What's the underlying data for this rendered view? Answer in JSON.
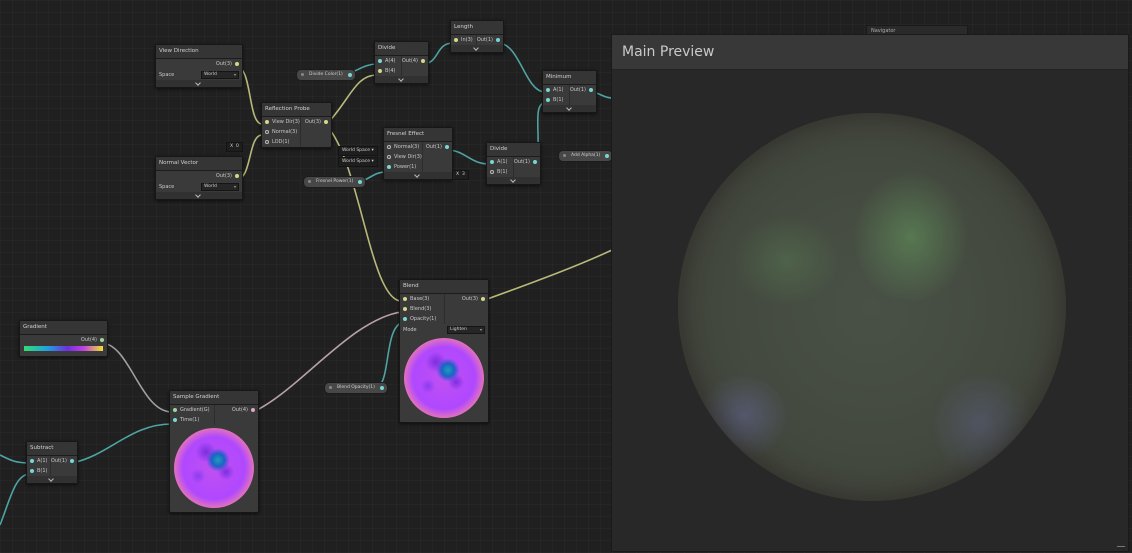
{
  "nodes": {
    "view_direction": {
      "title": "View Direction",
      "out": "Out(3)",
      "space_label": "Space",
      "space_value": "World"
    },
    "normal_vector": {
      "title": "Normal Vector",
      "out": "Out(3)",
      "space_label": "Space",
      "space_value": "World"
    },
    "reflection_probe": {
      "title": "Reflection Probe",
      "in": [
        "View Dir(3)",
        "Normal(3)",
        "LOD(1)"
      ],
      "out": "Out(3)",
      "lod_axis": "X",
      "lod_value": "0"
    },
    "divide_top": {
      "title": "Divide",
      "in": [
        "A(4)",
        "B(4)"
      ],
      "out": "Out(4)"
    },
    "length": {
      "title": "Length",
      "in": [
        "In(3)"
      ],
      "out": "Out(1)"
    },
    "minimum": {
      "title": "Minimum",
      "in": [
        "A(1)",
        "B(1)"
      ],
      "out": "Out(1)"
    },
    "fresnel": {
      "title": "Fresnel Effect",
      "in": [
        "Normal(3)",
        "View Dir(3)",
        "Power(1)"
      ],
      "out": "Out(1)",
      "normal_tag": "World Space",
      "view_tag": "World Space"
    },
    "divide_mid": {
      "title": "Divide",
      "in": [
        "A(1)",
        "B(1)"
      ],
      "out": "Out(1)",
      "b_axis": "X",
      "b_value": "3"
    },
    "blend": {
      "title": "Blend",
      "in": [
        "Base(3)",
        "Blend(3)",
        "Opacity(1)"
      ],
      "out": "Out(3)",
      "mode_label": "Mode",
      "mode_value": "Lighten"
    },
    "gradient": {
      "title": "Gradient",
      "out": "Out(4)"
    },
    "sample_gradient": {
      "title": "Sample Gradient",
      "in": [
        "Gradient(G)",
        "Time(1)"
      ],
      "out": "Out(4)"
    },
    "subtract": {
      "title": "Subtract",
      "in": [
        "A(1)",
        "B(1)"
      ],
      "out": "Out(1)"
    }
  },
  "properties": {
    "divide_color": "Divide Color(1)",
    "fresnel_power": "Fresnel Power(1)",
    "add_alpha": "Add Alpha(1)",
    "blend_opacity": "Blend Opacity(1)"
  },
  "main_preview": {
    "title": "Main Preview"
  },
  "bg_panel": {
    "title": "Navigator"
  },
  "colors": {
    "vector3": "#d7d78a",
    "vector1": "#7ad6d6",
    "vector4": "#e0a6c8",
    "gradient": "#9fd79f"
  }
}
